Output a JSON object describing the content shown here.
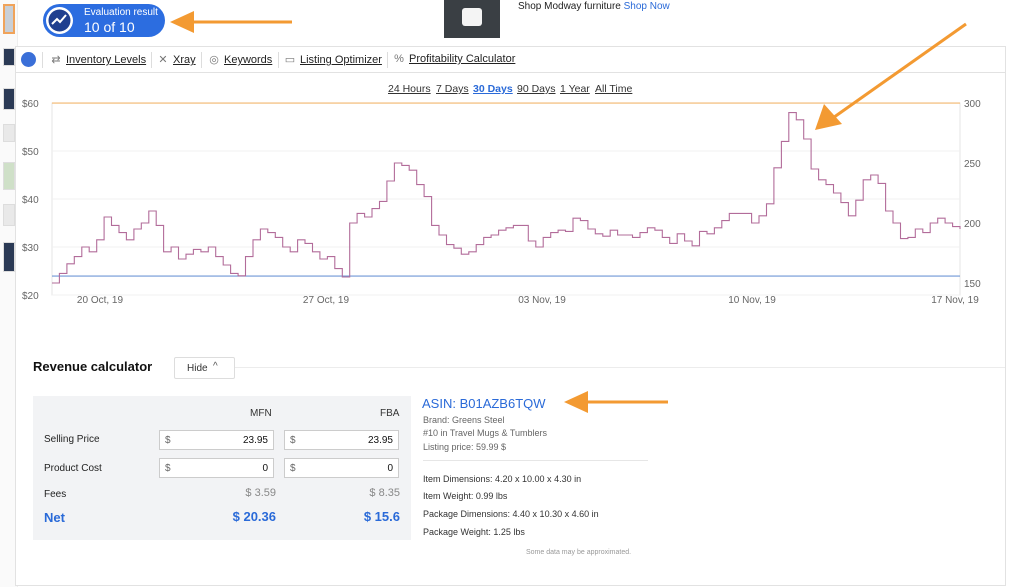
{
  "evaluation": {
    "title": "Evaluation result",
    "score": "10 of 10"
  },
  "ad": {
    "text": "Shop Modway furniture",
    "link": "Shop Now"
  },
  "toolbar": {
    "items": [
      {
        "label": "Inventory Levels",
        "icon": "inventory-icon"
      },
      {
        "label": "Xray",
        "icon": "xray-icon"
      },
      {
        "label": "Keywords",
        "icon": "keywords-icon"
      },
      {
        "label": "Listing Optimizer",
        "icon": "listing-icon"
      },
      {
        "label": "Profitability Calculator",
        "icon": "percent-icon"
      }
    ]
  },
  "ranges": [
    "24 Hours",
    "7 Days",
    "30 Days",
    "90 Days",
    "1 Year",
    "All Time"
  ],
  "active_range": "30 Days",
  "chart_data": {
    "type": "line",
    "left_axis": {
      "ticks": [
        "$60",
        "$50",
        "$40",
        "$30",
        "$20"
      ],
      "range": [
        20,
        60
      ]
    },
    "right_axis": {
      "ticks": [
        "300",
        "250",
        "200",
        "150"
      ],
      "range": [
        140,
        300
      ]
    },
    "x_ticks": [
      "20 Oct, 19",
      "27 Oct, 19",
      "03 Nov, 19",
      "10 Nov, 19",
      "17 Nov, 19"
    ],
    "reference_lines": [
      {
        "value": 59.99,
        "axis": "left",
        "color": "#f2b66d"
      },
      {
        "value": 23.95,
        "axis": "left",
        "color": "#6f97d6"
      }
    ],
    "series": [
      {
        "axis": "right",
        "color": "#b26c9a",
        "values": [
          150,
          158,
          166,
          172,
          180,
          176,
          186,
          205,
          198,
          192,
          186,
          195,
          200,
          210,
          198,
          176,
          180,
          170,
          174,
          178,
          176,
          180,
          172,
          165,
          158,
          156,
          172,
          186,
          195,
          192,
          188,
          180,
          176,
          186,
          183,
          176,
          170,
          172,
          162,
          155,
          200,
          208,
          205,
          212,
          218,
          235,
          250,
          248,
          244,
          232,
          222,
          198,
          190,
          182,
          179,
          174,
          176,
          182,
          188,
          190,
          194,
          196,
          198,
          198,
          185,
          180,
          188,
          192,
          194,
          193,
          204,
          202,
          195,
          191,
          189,
          194,
          190,
          190,
          188,
          192,
          196,
          194,
          188,
          183,
          191,
          185,
          181,
          193,
          191,
          196,
          202,
          208,
          208,
          208,
          200,
          206,
          216,
          246,
          268,
          292,
          286,
          270,
          245,
          236,
          232,
          225,
          217,
          206,
          219,
          236,
          240,
          233,
          210,
          200,
          187,
          188,
          195,
          192,
          200,
          204,
          200,
          197,
          195
        ]
      }
    ]
  },
  "revenue": {
    "title": "Revenue calculator",
    "hide_label": "Hide",
    "col_mfn": "MFN",
    "col_fba": "FBA",
    "selling_price_label": "Selling Price",
    "product_cost_label": "Product Cost",
    "fees_label": "Fees",
    "net_label": "Net",
    "currency": "$",
    "mfn": {
      "selling_price": "23.95",
      "product_cost": "0",
      "fees": "$ 3.59",
      "net": "$ 20.36"
    },
    "fba": {
      "selling_price": "23.95",
      "product_cost": "0",
      "fees": "$ 8.35",
      "net": "$ 15.6"
    }
  },
  "product": {
    "asin": "ASIN: B01AZB6TQW",
    "brand": "Brand: Greens Steel",
    "rank": "#10 in Travel Mugs & Tumblers",
    "listing_price": "Listing price: 59.99 $",
    "item_dimensions": "Item Dimensions: 4.20 x 10.00 x 4.30 in",
    "item_weight": "Item Weight: 0.99 lbs",
    "package_dimensions": "Package Dimensions: 4.40 x 10.30 x 4.60 in",
    "package_weight": "Package Weight: 1.25 lbs",
    "approx_note": "Some data may be approximated."
  }
}
